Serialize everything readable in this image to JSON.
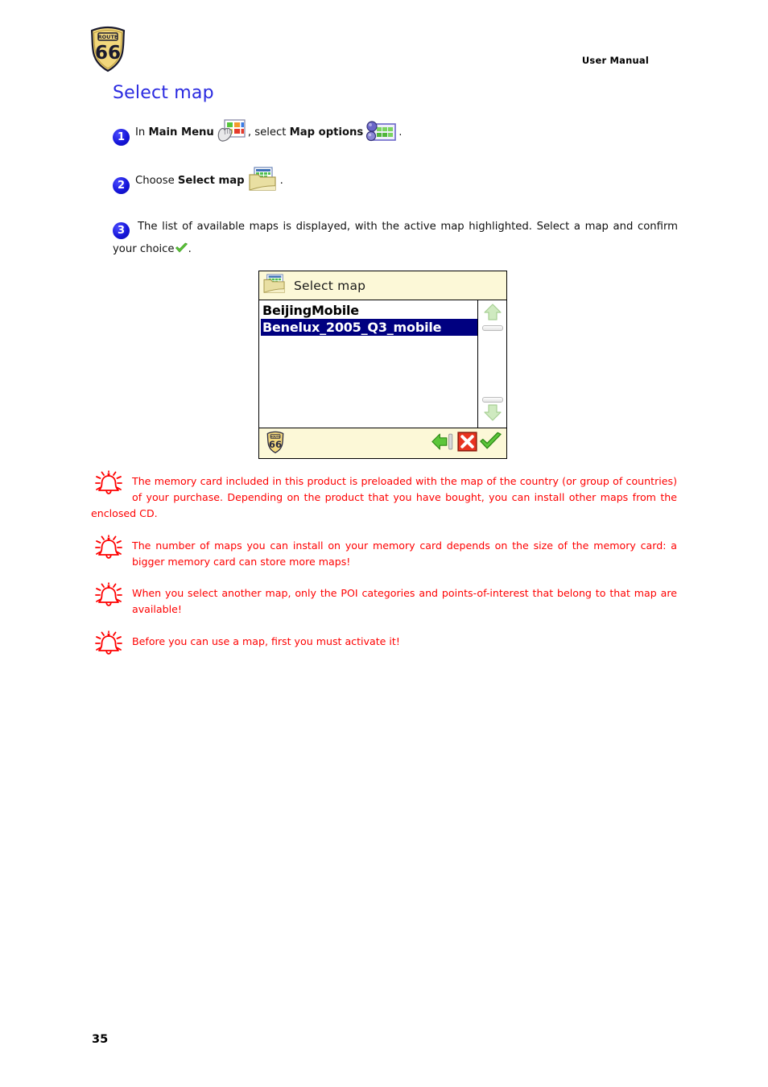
{
  "header": {
    "logo_alt": "route66-logo",
    "logo_top_text": "ROUTE",
    "logo_number": "66",
    "right_label": "User Manual"
  },
  "title": "Select map",
  "steps": [
    {
      "number": "1",
      "text_before": "In ",
      "bold1": "Main Menu",
      "icon1": "main-menu-icon",
      "text_middle": ", select ",
      "bold2": "Map options",
      "icon2": "map-options-icon",
      "text_after": "."
    },
    {
      "number": "2",
      "text_before": "Choose ",
      "bold1": "Select map",
      "icon1": "select-map-folder-icon",
      "text_after": "."
    },
    {
      "number": "3",
      "text": "The list of available maps is displayed, with the active map highlighted. Select a map and confirm your choice",
      "icon": "green-check-icon",
      "text_after": "."
    }
  ],
  "device": {
    "titlebar": {
      "icon": "map-folder-icon",
      "title": "Select map"
    },
    "list": [
      {
        "label": "BeijingMobile",
        "selected": false
      },
      {
        "label": "Benelux_2005_Q3_mobile",
        "selected": true
      }
    ],
    "scrollbar": {
      "up_icon": "scroll-up-arrow-icon",
      "down_icon": "scroll-down-arrow-icon"
    },
    "toolbar": {
      "logo": "route66-logo-small",
      "logo_top_text": "ROUTE",
      "logo_number": "66",
      "buttons": [
        {
          "name": "back-button",
          "icon": "green-left-arrow-icon"
        },
        {
          "name": "cancel-button",
          "icon": "red-x-icon"
        },
        {
          "name": "confirm-button",
          "icon": "green-check-icon"
        }
      ]
    },
    "colors": {
      "titlebar_bg": "#fcf8d7",
      "selection_bg": "#000080",
      "selection_fg": "#ffffff",
      "border": "#000000"
    }
  },
  "notes": [
    {
      "icon": "bell-icon",
      "text": "The memory card included in this product is preloaded with the map of the country (or group of countries) of your purchase. Depending on the product that you have bought, you can install other maps from the enclosed CD."
    },
    {
      "icon": "bell-icon",
      "text": "The number of maps you can install on your memory card depends on the size of the memory card: a bigger memory card can store more maps!"
    },
    {
      "icon": "bell-icon",
      "text": "When you select another map, only the POI categories and points-of-interest that belong to that map are available!"
    },
    {
      "icon": "bell-icon",
      "text": "Before you can use a map, first you must activate it!"
    }
  ],
  "page_number": "35",
  "colors": {
    "title_blue": "#2a2ae0",
    "note_red": "#fe0000",
    "badge_blue": "#1414d8"
  }
}
